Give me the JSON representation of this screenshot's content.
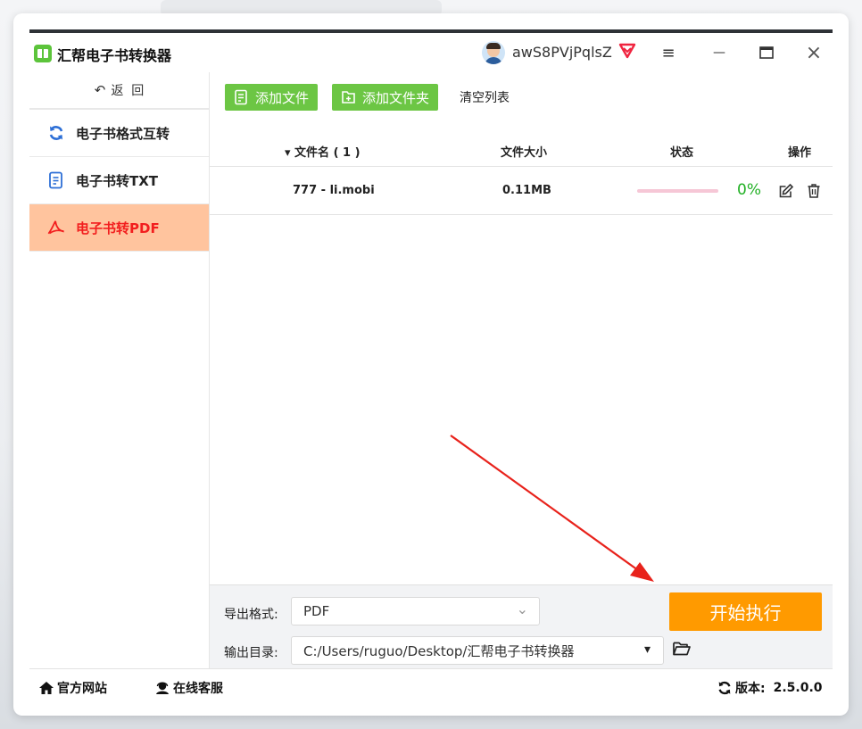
{
  "app": {
    "title": "汇帮电子书转换器"
  },
  "user": {
    "name": "awS8PVjPqlsZ"
  },
  "window_controls": {
    "menu": "≡",
    "minimize": "—",
    "maximize": "□",
    "close": "×"
  },
  "sidebar": {
    "back": {
      "arrow": "↶",
      "label": "返  回"
    },
    "items": [
      {
        "label": "电子书格式互转",
        "icon": "refresh-icon",
        "active": false
      },
      {
        "label": "电子书转TXT",
        "icon": "document-icon",
        "active": false
      },
      {
        "label": "电子书转PDF",
        "icon": "pdf-icon",
        "active": true
      }
    ]
  },
  "toolbar": {
    "add_file": "添加文件",
    "add_folder": "添加文件夹",
    "clear_list": "清空列表"
  },
  "table": {
    "headers": {
      "filename": "▾ 文件名 ( 1 )",
      "size": "文件大小",
      "status": "状态",
      "actions": "操作"
    },
    "rows": [
      {
        "filename": "777 - li.mobi",
        "size": "0.11MB",
        "progress": 0,
        "progress_text": "0%"
      }
    ]
  },
  "export": {
    "format_label": "导出格式:",
    "format_value": "PDF",
    "format_arrow": "⌄",
    "dir_label": "输出目录:",
    "dir_value": "C:/Users/ruguo/Desktop/汇帮电子书转换器",
    "dir_arrow": "▾"
  },
  "start_button": "开始执行",
  "footer": {
    "website": "官方网站",
    "support": "在线客服",
    "version_label": "版本:",
    "version": "2.5.0.0"
  },
  "colors": {
    "accent_green": "#6cc644",
    "accent_orange": "#ff9a00",
    "active_bg": "#ffc49e",
    "active_text": "#f21e1e",
    "progress": "#e94b7b",
    "percent_text": "#21b024",
    "annotation_arrow": "#e8221b"
  }
}
